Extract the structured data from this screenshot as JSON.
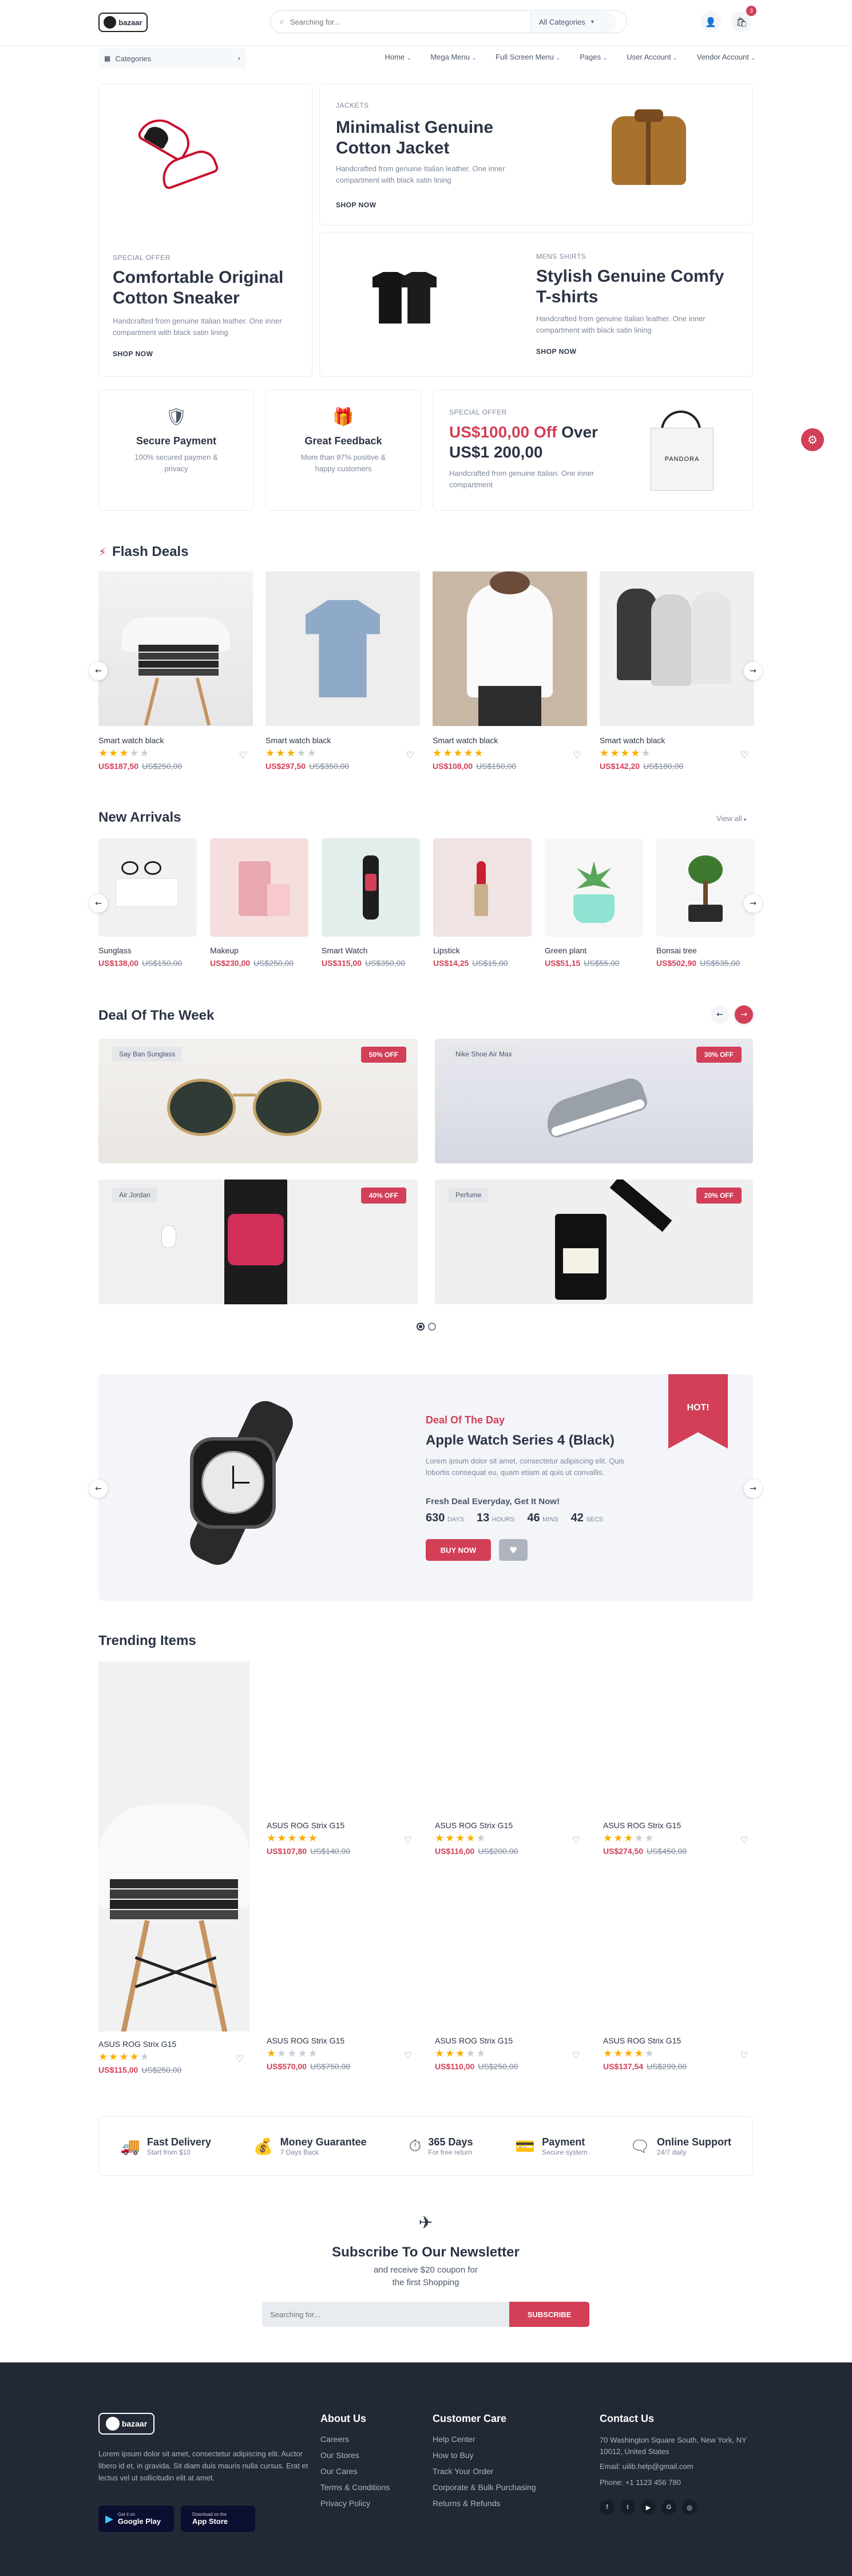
{
  "header": {
    "logo": "bazaar",
    "search_placeholder": "Searching for...",
    "category_select": "All Categories",
    "cart_count": "3",
    "nav": [
      "Home",
      "Mega Menu",
      "Full Screen Menu",
      "Pages",
      "User Account",
      "Vendor Account"
    ],
    "categories_label": "Categories"
  },
  "hero": [
    {
      "tag": "JACKETS",
      "title": "Minimalist Genuine Cotton Jacket",
      "desc": "Handcrafted from genuine Italian leather. One inner compartment with black satin lining",
      "cta": "SHOP NOW"
    },
    {
      "tag": "SPECIAL OFFER",
      "title": "Comfortable Original Cotton Sneaker",
      "desc": "Handcrafted from genuine Italian leather. One inner compartment with black satin lining",
      "cta": "SHOP NOW"
    },
    {
      "tag": "MENS SHIRTS",
      "title": "Stylish Genuine Comfy T-shirts",
      "desc": "Handcrafted from genuine Italian leather. One inner compartment with black satin lining",
      "cta": "SHOP NOW"
    }
  ],
  "service_cards": [
    {
      "title": "Secure Payment",
      "desc": "100% secured paymen & privacy"
    },
    {
      "title": "Great Feedback",
      "desc": "More than 97% positive & happy customers"
    }
  ],
  "offer": {
    "tag": "SPECIAL OFFER",
    "price_highlight": "US$100,00 Off",
    "price_rest": "Over US$1 200,00",
    "desc": "Handcrafted from genuine Italian. One inner compartment",
    "bag_label": "PANDORA"
  },
  "flash": {
    "title": "Flash Deals",
    "items": [
      {
        "name": "Smart watch black",
        "price": "US$187,50",
        "old": "US$250,00",
        "rating": 3
      },
      {
        "name": "Smart watch black",
        "price": "US$297,50",
        "old": "US$350,00",
        "rating": 3
      },
      {
        "name": "Smart watch black",
        "price": "US$108,00",
        "old": "US$150,00",
        "rating": 5
      },
      {
        "name": "Smart watch black",
        "price": "US$142,20",
        "old": "US$180,00",
        "rating": 4
      }
    ]
  },
  "arrivals": {
    "title": "New Arrivals",
    "view_all": "View all",
    "items": [
      {
        "name": "Sunglass",
        "price": "US$138,00",
        "old": "US$150,00"
      },
      {
        "name": "Makeup",
        "price": "US$230,00",
        "old": "US$250,00"
      },
      {
        "name": "Smart Watch",
        "price": "US$315,00",
        "old": "US$350,00"
      },
      {
        "name": "Lipstick",
        "price": "US$14,25",
        "old": "US$15,00"
      },
      {
        "name": "Green plant",
        "price": "US$51,15",
        "old": "US$55,00"
      },
      {
        "name": "Bonsai tree",
        "price": "US$502,90",
        "old": "US$535,00"
      }
    ]
  },
  "deal_week": {
    "title": "Deal Of The Week",
    "items": [
      {
        "label": "Say Ban Sunglass",
        "off": "50% OFF"
      },
      {
        "label": "Nike Shoe Air Max",
        "off": "30% OFF"
      },
      {
        "label": "Air Jordan",
        "off": "40% OFF"
      },
      {
        "label": "Perfume",
        "off": "20% OFF"
      }
    ]
  },
  "deal_day": {
    "tag": "Deal Of The Day",
    "title": "Apple Watch Series 4 (Black)",
    "desc": "Lorem ipsum dolor sit amet, consectetur adipiscing elit. Quis lobortis consequat eu, quam etiam at quis ut convallis.",
    "fresh": "Fresh Deal Everyday, Get It Now!",
    "timer": [
      {
        "v": "630",
        "u": "DAYS"
      },
      {
        "v": "13",
        "u": "HOURS"
      },
      {
        "v": "46",
        "u": "MINS"
      },
      {
        "v": "42",
        "u": "SECS"
      }
    ],
    "buy": "BUY NOW",
    "hot": "HOT!"
  },
  "trending": {
    "title": "Trending Items",
    "big": {
      "name": "ASUS ROG Strix G15",
      "price": "US$115,00",
      "old": "US$250,00",
      "rating": 4
    },
    "items": [
      {
        "name": "ASUS ROG Strix G15",
        "price": "US$107,80",
        "old": "US$140,00",
        "rating": 5
      },
      {
        "name": "ASUS ROG Strix G15",
        "price": "US$116,00",
        "old": "US$200,00",
        "rating": 4
      },
      {
        "name": "ASUS ROG Strix G15",
        "price": "US$274,50",
        "old": "US$450,00",
        "rating": 3
      },
      {
        "name": "ASUS ROG Strix G15",
        "price": "US$570,00",
        "old": "US$750,00",
        "rating": 1
      },
      {
        "name": "ASUS ROG Strix G15",
        "price": "US$110,00",
        "old": "US$250,00",
        "rating": 3
      },
      {
        "name": "ASUS ROG Strix G15",
        "price": "US$137,54",
        "old": "US$299,00",
        "rating": 4
      }
    ]
  },
  "services": [
    {
      "title": "Fast Delivery",
      "desc": "Start from $10"
    },
    {
      "title": "Money Guarantee",
      "desc": "7 Days Back"
    },
    {
      "title": "365 Days",
      "desc": "For free return"
    },
    {
      "title": "Payment",
      "desc": "Secure system"
    },
    {
      "title": "Online Support",
      "desc": "24/7 daily"
    }
  ],
  "newsletter": {
    "title": "Subscribe To Our Newsletter",
    "sub1": "and receive $20 coupon for",
    "sub2": "the first Shopping",
    "placeholder": "Searching for...",
    "button": "SUBSCRIBE"
  },
  "footer": {
    "logo": "bazaar",
    "about_text": "Lorem ipsum dolor sit amet, consectetur adipiscing elit. Auctor libero id et, in gravida. Sit diam duis mauris nulla cursus. Erat et lectus vel ut sollicitudin elit at amet.",
    "google_small": "Get it on",
    "google": "Google Play",
    "apple_small": "Download on the",
    "apple": "App Store",
    "about_title": "About Us",
    "about_links": [
      "Careers",
      "Our Stores",
      "Our Cares",
      "Terms & Conditions",
      "Privacy Policy"
    ],
    "care_title": "Customer Care",
    "care_links": [
      "Help Center",
      "How to Buy",
      "Track Your Order",
      "Corporate & Bulk Purchasing",
      "Returns & Refunds"
    ],
    "contact_title": "Contact Us",
    "address": "70 Washington Square South, New York, NY 10012, United States",
    "email": "Email: uilib.help@gmail.com",
    "phone": "Phone: +1 1123 456 780"
  },
  "colors": {
    "primary": "#d23f57",
    "dark": "#2b3445",
    "footer": "#222935"
  }
}
